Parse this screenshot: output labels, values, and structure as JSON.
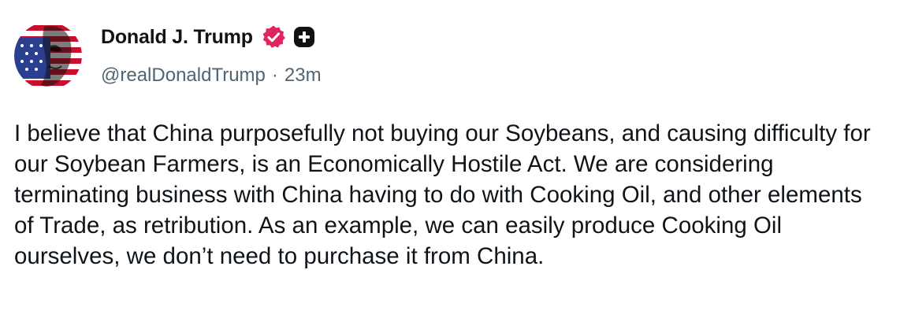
{
  "author": {
    "display_name": "Donald J. Trump",
    "handle": "@realDonaldTrump",
    "separator": "·",
    "time_ago": "23m",
    "verified_icon": "verified-badge-icon",
    "plus_icon": "plus-badge-icon",
    "colors": {
      "verified_badge": "#e0245e",
      "plus_badge": "#111111"
    }
  },
  "post": {
    "text": "I believe that China purposefully not buying our Soybeans, and causing difficulty for our Soybean Farmers, is an Economically Hostile Act. We are considering terminating business with China having to do with Cooking Oil, and other elements of Trade, as retribution. As an example, we can easily produce Cooking Oil ourselves, we don’t need to purchase it from China."
  }
}
